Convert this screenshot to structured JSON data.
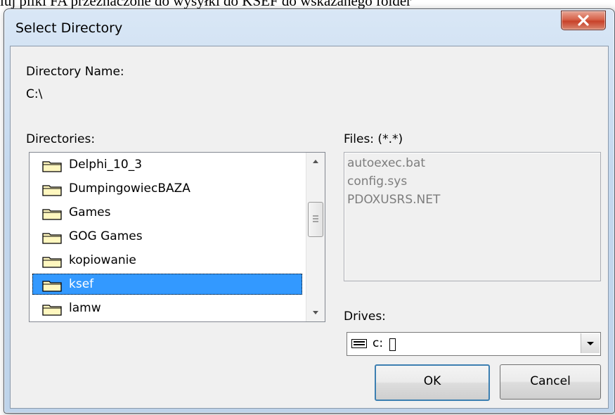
{
  "background": {
    "text": "luj pliki FA przeznaczone do wysyłki do KSEF do wskazanego folder"
  },
  "window": {
    "title": "Select Directory"
  },
  "directory_name": {
    "label": "Directory Name:",
    "value": "C:\\"
  },
  "directories": {
    "label": "Directories:",
    "items": [
      {
        "name": "Delphi_10_3",
        "icon": "folder-icon"
      },
      {
        "name": "DumpingowiecBAZA",
        "icon": "folder-icon"
      },
      {
        "name": "Games",
        "icon": "folder-icon"
      },
      {
        "name": "GOG Games",
        "icon": "folder-icon"
      },
      {
        "name": "kopiowanie",
        "icon": "folder-icon"
      },
      {
        "name": "ksef",
        "icon": "folder-icon",
        "selected": true
      },
      {
        "name": "lamw",
        "icon": "folder-icon"
      }
    ]
  },
  "files": {
    "label": "Files: (*.*)",
    "items": [
      "autoexec.bat",
      "config.sys",
      "PDOXUSRS.NET"
    ]
  },
  "drives": {
    "label": "Drives:",
    "selected": "c:",
    "icon": "drive-icon"
  },
  "buttons": {
    "ok": "OK",
    "cancel": "Cancel"
  },
  "colors": {
    "selection": "#3399ff",
    "close_button": "#c8422a",
    "dialog_frame": "#c4d8ee"
  }
}
